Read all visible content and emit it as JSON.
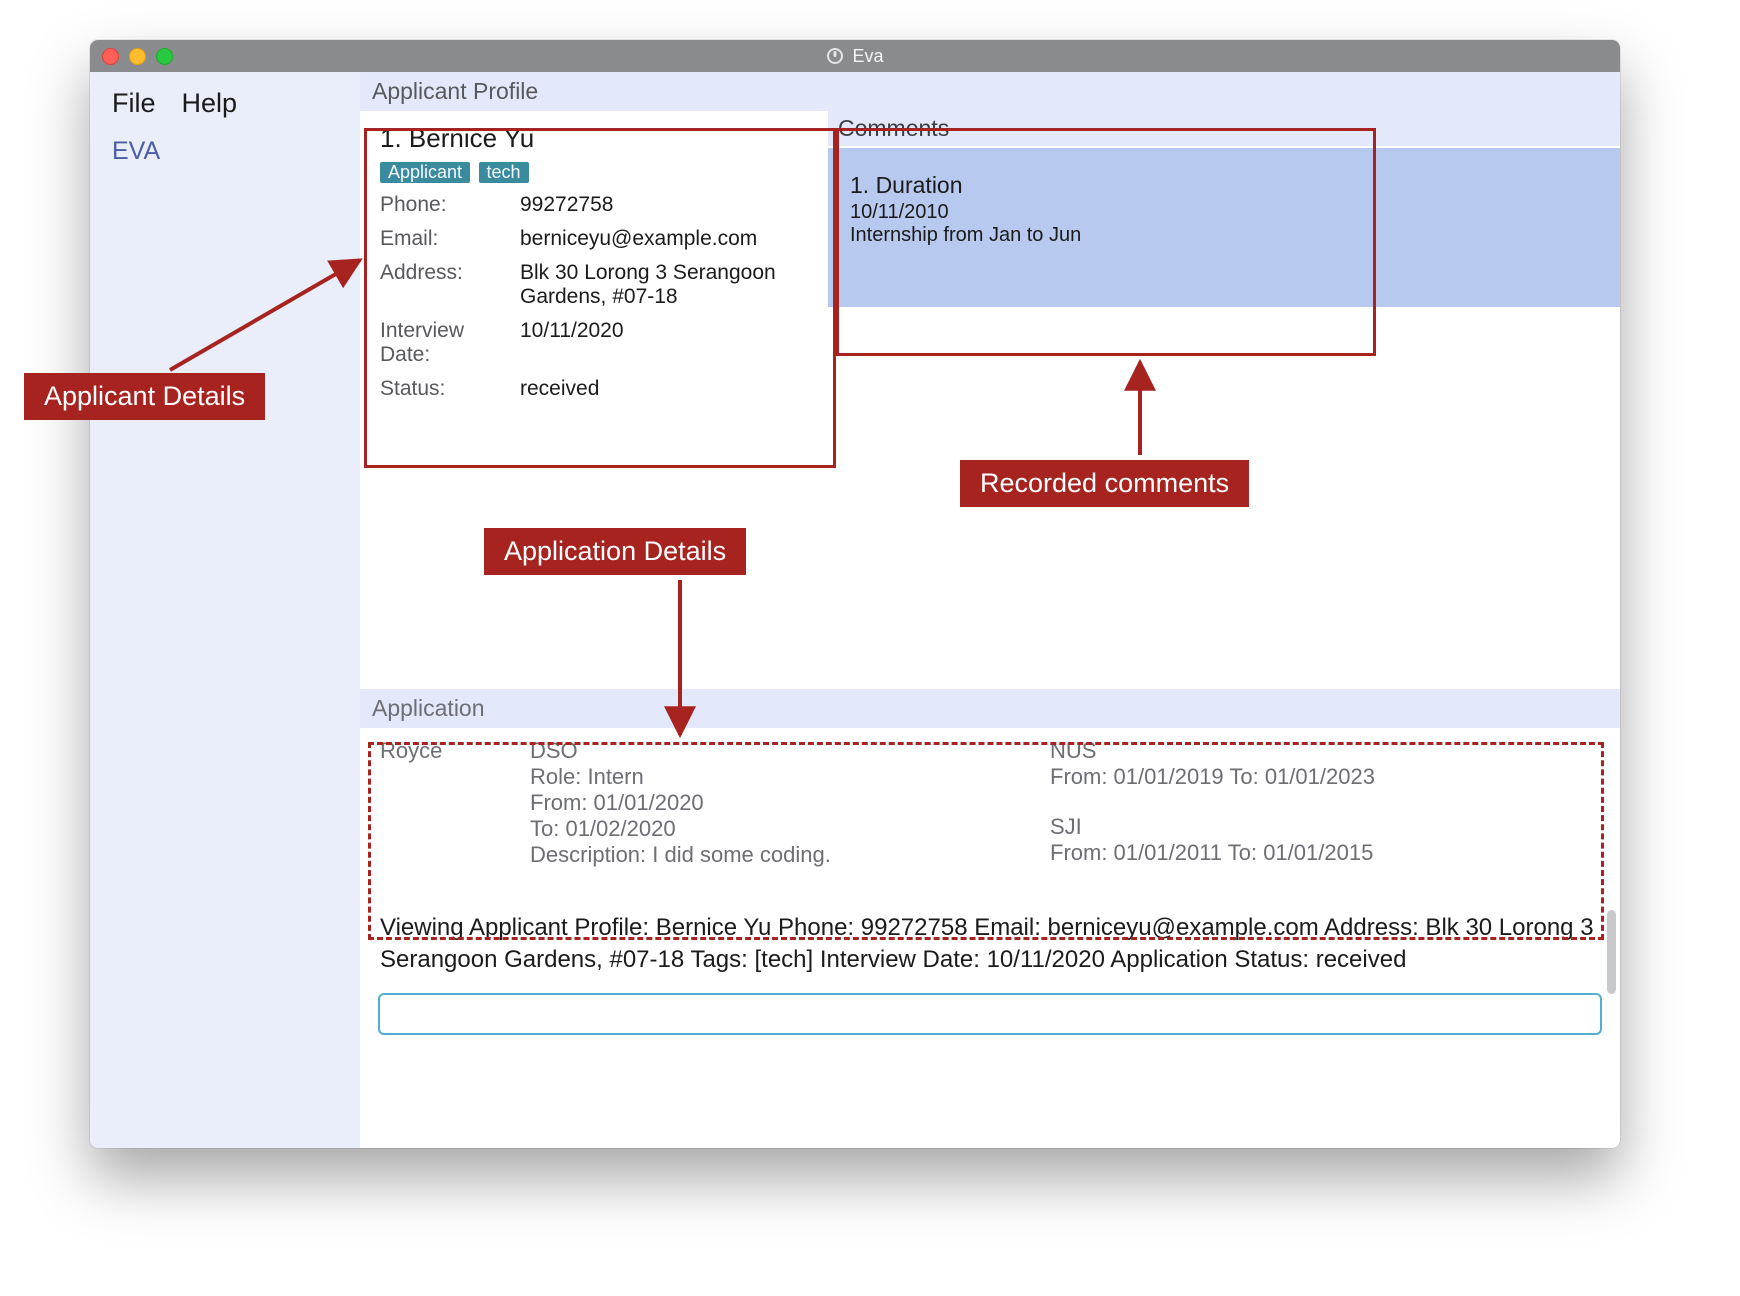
{
  "window": {
    "title": "Eva"
  },
  "menubar": {
    "file": "File",
    "help": "Help"
  },
  "sidebar": {
    "brand": "EVA"
  },
  "headers": {
    "profile": "Applicant Profile",
    "comments": "Comments",
    "application": "Application"
  },
  "applicant": {
    "index_name": "1.  Bernice Yu",
    "tags": {
      "t1": "Applicant",
      "t2": "tech"
    },
    "fields": {
      "phone_k": "Phone:",
      "phone_v": "99272758",
      "email_k": "Email:",
      "email_v": "berniceyu@example.com",
      "address_k": "Address:",
      "address_v": "Blk 30 Lorong 3 Serangoon Gardens, #07-18",
      "interview_k": "Interview Date:",
      "interview_v": "10/11/2020",
      "status_k": "Status:",
      "status_v": "received"
    }
  },
  "comments": {
    "c1": {
      "title": "1.  Duration",
      "date": "10/11/2010",
      "text": "Internship from Jan to Jun"
    }
  },
  "application": {
    "col1": "Royce",
    "col2": {
      "l1": "DSO",
      "l2": "Role: Intern",
      "l3": "From: 01/01/2020",
      "l4": "To: 01/02/2020",
      "l5": "Description: I did some coding."
    },
    "col3": {
      "e1": {
        "name": "NUS",
        "range": "From: 01/01/2019 To: 01/01/2023"
      },
      "e2": {
        "name": "SJI",
        "range": "From: 01/01/2011 To: 01/01/2015"
      }
    }
  },
  "status_view": "Viewing Applicant Profile: Bernice Yu Phone: 99272758 Email: berniceyu@example.com Address: Blk 30 Lorong 3 Serangoon Gardens, #07-18 Tags: [tech] Interview Date: 10/11/2020 Application Status: received",
  "command_input": {
    "value": ""
  },
  "annotations": {
    "applicant_details": "Applicant Details",
    "application_details": "Application Details",
    "recorded_comments": "Recorded comments"
  }
}
